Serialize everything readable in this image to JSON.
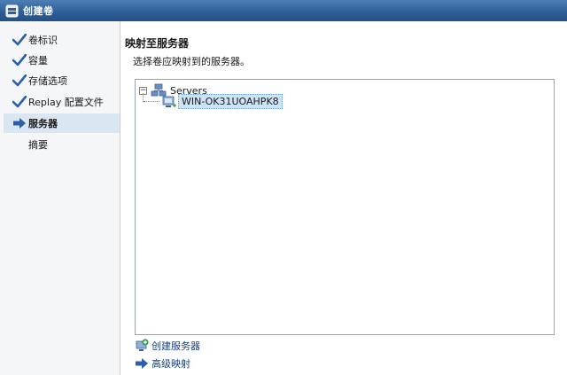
{
  "window": {
    "title": "创建卷"
  },
  "sidebar": {
    "items": [
      {
        "label": "卷标识",
        "state": "done"
      },
      {
        "label": "容量",
        "state": "done"
      },
      {
        "label": "存储选项",
        "state": "done"
      },
      {
        "label": "Replay 配置文件",
        "state": "done"
      },
      {
        "label": "服务器",
        "state": "current"
      },
      {
        "label": "摘要",
        "state": "pending"
      }
    ]
  },
  "main": {
    "title": "映射至服务器",
    "description": "选择卷应映射到的服务器。",
    "tree": {
      "root": {
        "label": "Servers",
        "expander": "−"
      },
      "children": [
        {
          "label": "WIN-OK31UOAHPK8",
          "selected": true
        }
      ]
    },
    "actions": [
      {
        "label": "创建服务器",
        "icon": "create-server-icon"
      },
      {
        "label": "高级映射",
        "icon": "arrow-right-icon"
      }
    ]
  },
  "colors": {
    "titlebar": "#2f5f98",
    "check": "#2c5fa8",
    "selected_bg": "#dbe6f3",
    "tree_selected": "#cfe3f7"
  }
}
